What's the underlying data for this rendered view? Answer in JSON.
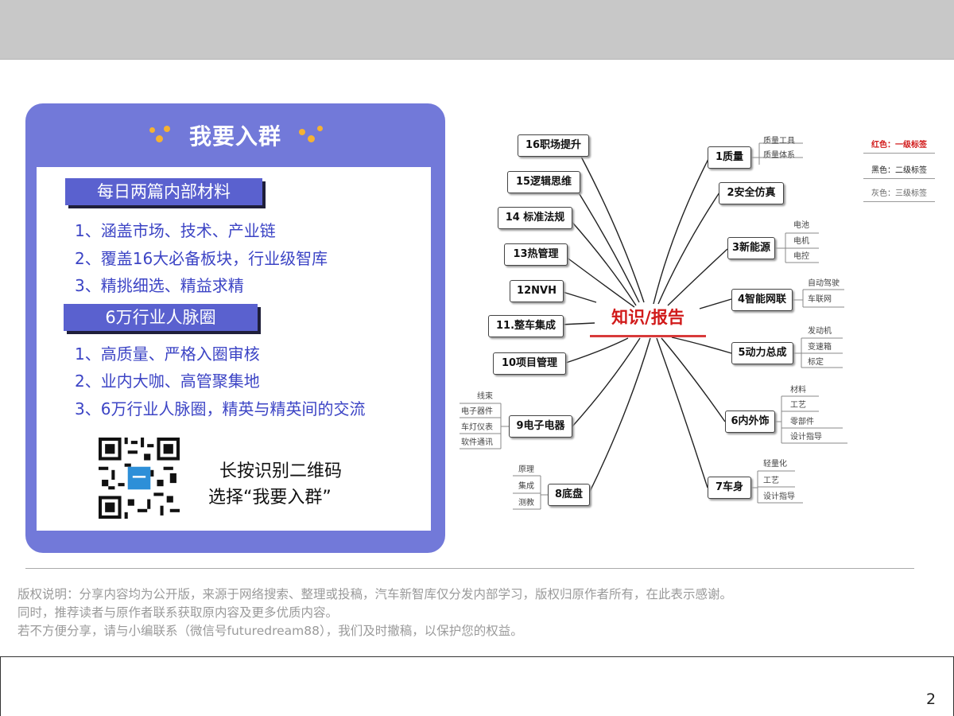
{
  "promo": {
    "title": "我要入群",
    "section1": "每日两篇内部材料",
    "section1_lines": [
      "1、涵盖市场、技术、产业链",
      "2、覆盖16大必备板块，行业级智库",
      "3、精挑细选、精益求精"
    ],
    "section2": "6万行业人脉圈",
    "section2_lines": [
      "1、高质量、严格入圈审核",
      "2、业内大咖、高管聚集地",
      "3、6万行业人脉圈，精英与精英间的交流"
    ],
    "qr_line1": "长按识别二维码",
    "qr_line2": "选择“我要入群”"
  },
  "mindmap": {
    "center": "知识/报告",
    "left_nodes": [
      "16职场提升",
      "15逻辑思维",
      "14 标准法规",
      "13热管理",
      "12NVH",
      "11.整车集成",
      "10项目管理",
      "9电子电器",
      "8底盘"
    ],
    "right_nodes": [
      "1质量",
      "2安全仿真",
      "3新能源",
      "4智能网联",
      "5动力总成",
      "6内外饰",
      "7车身"
    ],
    "leaves": {
      "n1": [
        "质量工具",
        "质量体系"
      ],
      "n3": [
        "电池",
        "电机",
        "电控"
      ],
      "n4": [
        "自动驾驶",
        "车联网"
      ],
      "n5": [
        "发动机",
        "变速箱",
        "标定"
      ],
      "n6": [
        "材料",
        "工艺",
        "零部件",
        "设计指导"
      ],
      "n7": [
        "轻量化",
        "工艺",
        "设计指导"
      ],
      "n8": [
        "原理",
        "集成",
        "测教"
      ],
      "n9": [
        "线束",
        "电子器件",
        "车灯仪表",
        "软件通讯"
      ]
    },
    "legend": [
      "红色：一级标签",
      "黑色：二级标签",
      "灰色：三级标签"
    ]
  },
  "footer": {
    "line1": "版权说明：分享内容均为公开版，来源于网络搜索、整理或投稿，汽车新智库仅分发内部学习，版权归原作者所有，在此表示感谢。",
    "line2": "同时，推荐读者与原作者联系获取原内容及更多优质内容。",
    "line3": "若不方便分享，请与小编联系（微信号futuredream88），我们及时撤稿，以保护您的权益。"
  },
  "page_number": "2",
  "colors": {
    "card": "#7279d9",
    "section": "#5a61cf",
    "text_blue": "#3c44c5",
    "center_red": "#d11a1a",
    "legend_red": "#d11a1a"
  }
}
